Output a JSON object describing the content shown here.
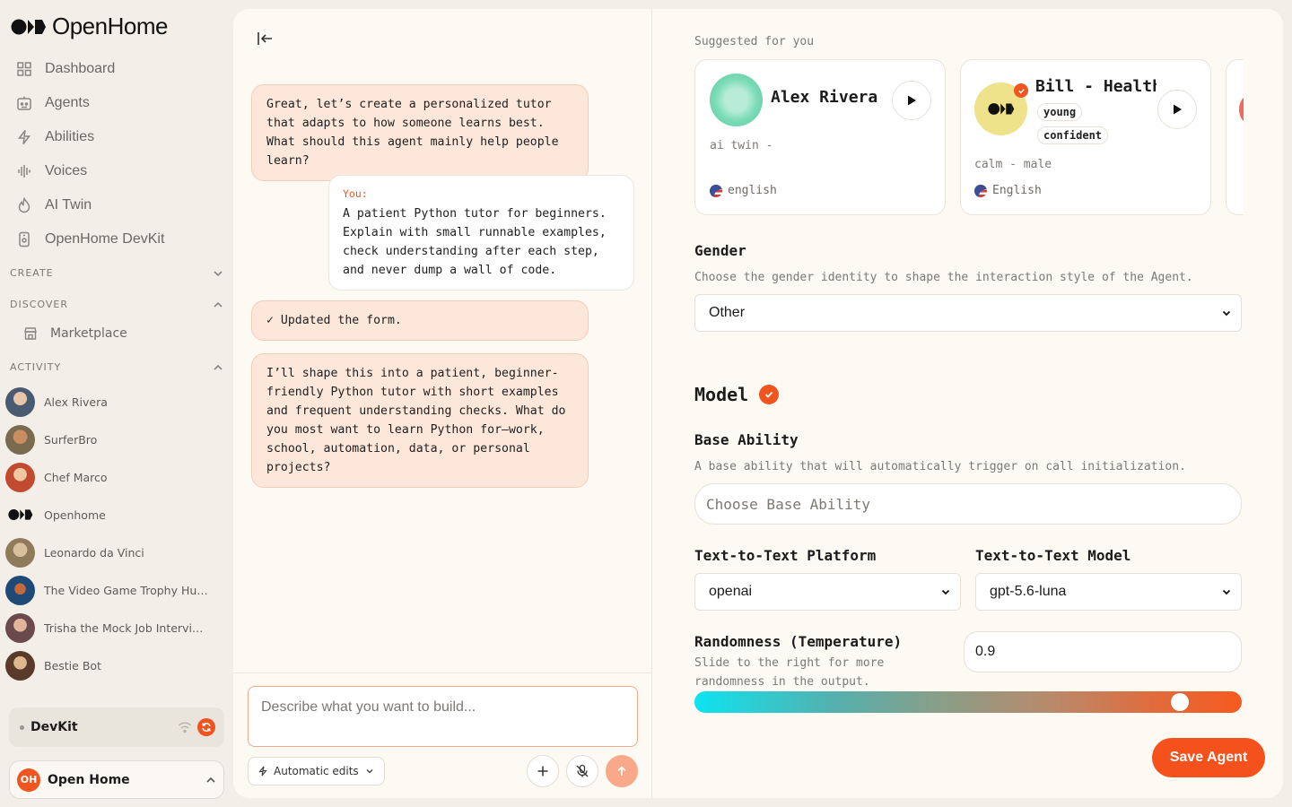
{
  "app": {
    "name": "OpenHome"
  },
  "nav": [
    {
      "label": "Dashboard",
      "icon": "grid-icon"
    },
    {
      "label": "Agents",
      "icon": "robot-icon"
    },
    {
      "label": "Abilities",
      "icon": "bolt-icon"
    },
    {
      "label": "Voices",
      "icon": "waveform-icon"
    },
    {
      "label": "AI Twin",
      "icon": "flame-icon"
    },
    {
      "label": "OpenHome DevKit",
      "icon": "device-icon"
    }
  ],
  "sections": {
    "create": "CREATE",
    "discover": "DISCOVER",
    "activity": "ACTIVITY"
  },
  "discover_items": [
    {
      "label": "Marketplace",
      "icon": "store-icon"
    }
  ],
  "activity": [
    {
      "label": "Alex Rivera",
      "avatar_color": "#5b6f86"
    },
    {
      "label": "SurferBro",
      "avatar_color": "#8a6a4c"
    },
    {
      "label": "Chef Marco",
      "avatar_color": "#b85a3a"
    },
    {
      "label": "Openhome",
      "avatar_color": "#f3efe8"
    },
    {
      "label": "Leonardo da Vinci",
      "avatar_color": "#9a8566"
    },
    {
      "label": "The Video Game Trophy Hu…",
      "avatar_color": "#3a5e8a"
    },
    {
      "label": "Trisha the Mock Job Intervi…",
      "avatar_color": "#7a5a5c"
    },
    {
      "label": "Bestie Bot",
      "avatar_color": "#6a4a3a"
    }
  ],
  "devkit": {
    "label": "DevKit"
  },
  "account": {
    "initials": "OH",
    "name": "Open Home"
  },
  "chat": {
    "messages": [
      {
        "role": "agent",
        "text": "Great, let’s create a personalized tutor that adapts to how someone learns best. What should this agent mainly help people learn?"
      },
      {
        "role": "user",
        "prefix": "You:",
        "text": "A patient Python tutor for beginners. Explain with small runnable examples, check understanding after each step, and never dump a wall of code."
      },
      {
        "role": "agent",
        "text": "✓ Updated the form."
      },
      {
        "role": "agent",
        "text": "I’ll shape this into a patient, beginner-friendly Python tutor with short examples and frequent understanding checks. What do you most want to learn Python for—work, school, automation, data, or personal projects?"
      }
    ],
    "composer_placeholder": "Describe what you want to build...",
    "auto_edits_label": "Automatic edits"
  },
  "form": {
    "suggested_label": "Suggested for you",
    "voices": [
      {
        "name": "Alex Rivera",
        "desc": "ai twin -",
        "lang": "english",
        "tags": []
      },
      {
        "name": "Bill - Health …",
        "desc": "calm - male",
        "lang": "English",
        "tags": [
          "young",
          "confident"
        ]
      }
    ],
    "gender": {
      "label": "Gender",
      "help": "Choose the gender identity to shape the interaction style of the Agent.",
      "value": "Other"
    },
    "model_title": "Model",
    "base_ability": {
      "label": "Base Ability",
      "help": "A base ability that will automatically trigger on call initialization.",
      "placeholder": "Choose Base Ability"
    },
    "platform": {
      "label": "Text-to-Text Platform",
      "value": "openai"
    },
    "model": {
      "label": "Text-to-Text Model",
      "value": "gpt-5.6-luna"
    },
    "temperature": {
      "label": "Randomness (Temperature)",
      "help": "Slide to the right for more randomness in the output.",
      "value": "0.9",
      "fraction": 0.9
    },
    "save_label": "Save Agent"
  },
  "colors": {
    "accent": "#f5511c",
    "bubble_agent": "#fde6da",
    "sidebar_bg": "#f3efe8",
    "panel_bg": "#fdf9f3"
  }
}
